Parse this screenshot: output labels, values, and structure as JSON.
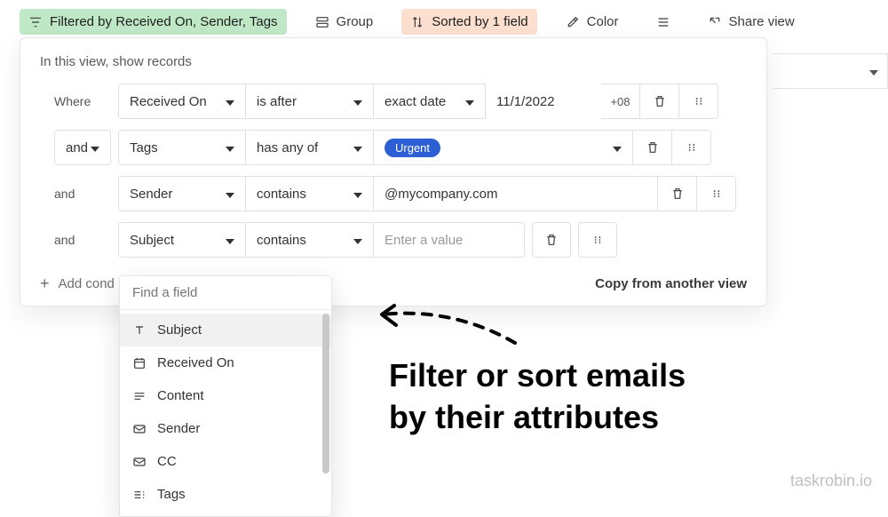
{
  "toolbar": {
    "filtered_label": "Filtered by Received On, Sender, Tags",
    "group_label": "Group",
    "sorted_label": "Sorted by 1 field",
    "color_label": "Color",
    "rowheight_label": "",
    "share_label": "Share view"
  },
  "panel": {
    "header": "In this view, show records",
    "rows": [
      {
        "conj": "Where",
        "field": "Received On",
        "operator": "is after",
        "mode": "exact date",
        "value": "11/1/2022",
        "tz": "+08"
      },
      {
        "conj": "and",
        "field": "Tags",
        "operator": "has any of",
        "tag_value": "Urgent"
      },
      {
        "conj": "and",
        "field": "Sender",
        "operator": "contains",
        "value": "@mycompany.com"
      },
      {
        "conj": "and",
        "field": "Subject",
        "operator": "contains",
        "placeholder": "Enter a value"
      }
    ],
    "add_condition_label": "Add cond",
    "copy_label": "Copy from another view"
  },
  "field_dropdown": {
    "search_placeholder": "Find a field",
    "items": [
      {
        "icon": "text",
        "label": "Subject"
      },
      {
        "icon": "calendar",
        "label": "Received On"
      },
      {
        "icon": "long",
        "label": "Content"
      },
      {
        "icon": "mail",
        "label": "Sender"
      },
      {
        "icon": "mail",
        "label": "CC"
      },
      {
        "icon": "tags",
        "label": "Tags"
      }
    ]
  },
  "annotation": {
    "line1": "Filter or sort emails",
    "line2": "by their attributes"
  },
  "watermark": "taskrobin.io"
}
